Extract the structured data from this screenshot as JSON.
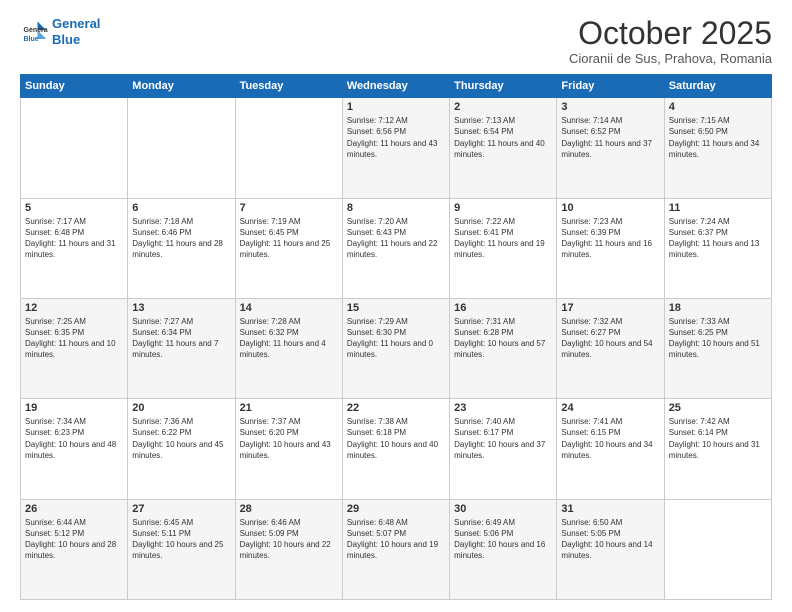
{
  "header": {
    "logo_line1": "General",
    "logo_line2": "Blue",
    "month": "October 2025",
    "location": "Cioranii de Sus, Prahova, Romania"
  },
  "days_of_week": [
    "Sunday",
    "Monday",
    "Tuesday",
    "Wednesday",
    "Thursday",
    "Friday",
    "Saturday"
  ],
  "weeks": [
    [
      {
        "day": "",
        "text": ""
      },
      {
        "day": "",
        "text": ""
      },
      {
        "day": "",
        "text": ""
      },
      {
        "day": "1",
        "text": "Sunrise: 7:12 AM\nSunset: 6:56 PM\nDaylight: 11 hours and 43 minutes."
      },
      {
        "day": "2",
        "text": "Sunrise: 7:13 AM\nSunset: 6:54 PM\nDaylight: 11 hours and 40 minutes."
      },
      {
        "day": "3",
        "text": "Sunrise: 7:14 AM\nSunset: 6:52 PM\nDaylight: 11 hours and 37 minutes."
      },
      {
        "day": "4",
        "text": "Sunrise: 7:15 AM\nSunset: 6:50 PM\nDaylight: 11 hours and 34 minutes."
      }
    ],
    [
      {
        "day": "5",
        "text": "Sunrise: 7:17 AM\nSunset: 6:48 PM\nDaylight: 11 hours and 31 minutes."
      },
      {
        "day": "6",
        "text": "Sunrise: 7:18 AM\nSunset: 6:46 PM\nDaylight: 11 hours and 28 minutes."
      },
      {
        "day": "7",
        "text": "Sunrise: 7:19 AM\nSunset: 6:45 PM\nDaylight: 11 hours and 25 minutes."
      },
      {
        "day": "8",
        "text": "Sunrise: 7:20 AM\nSunset: 6:43 PM\nDaylight: 11 hours and 22 minutes."
      },
      {
        "day": "9",
        "text": "Sunrise: 7:22 AM\nSunset: 6:41 PM\nDaylight: 11 hours and 19 minutes."
      },
      {
        "day": "10",
        "text": "Sunrise: 7:23 AM\nSunset: 6:39 PM\nDaylight: 11 hours and 16 minutes."
      },
      {
        "day": "11",
        "text": "Sunrise: 7:24 AM\nSunset: 6:37 PM\nDaylight: 11 hours and 13 minutes."
      }
    ],
    [
      {
        "day": "12",
        "text": "Sunrise: 7:25 AM\nSunset: 6:35 PM\nDaylight: 11 hours and 10 minutes."
      },
      {
        "day": "13",
        "text": "Sunrise: 7:27 AM\nSunset: 6:34 PM\nDaylight: 11 hours and 7 minutes."
      },
      {
        "day": "14",
        "text": "Sunrise: 7:28 AM\nSunset: 6:32 PM\nDaylight: 11 hours and 4 minutes."
      },
      {
        "day": "15",
        "text": "Sunrise: 7:29 AM\nSunset: 6:30 PM\nDaylight: 11 hours and 0 minutes."
      },
      {
        "day": "16",
        "text": "Sunrise: 7:31 AM\nSunset: 6:28 PM\nDaylight: 10 hours and 57 minutes."
      },
      {
        "day": "17",
        "text": "Sunrise: 7:32 AM\nSunset: 6:27 PM\nDaylight: 10 hours and 54 minutes."
      },
      {
        "day": "18",
        "text": "Sunrise: 7:33 AM\nSunset: 6:25 PM\nDaylight: 10 hours and 51 minutes."
      }
    ],
    [
      {
        "day": "19",
        "text": "Sunrise: 7:34 AM\nSunset: 6:23 PM\nDaylight: 10 hours and 48 minutes."
      },
      {
        "day": "20",
        "text": "Sunrise: 7:36 AM\nSunset: 6:22 PM\nDaylight: 10 hours and 45 minutes."
      },
      {
        "day": "21",
        "text": "Sunrise: 7:37 AM\nSunset: 6:20 PM\nDaylight: 10 hours and 43 minutes."
      },
      {
        "day": "22",
        "text": "Sunrise: 7:38 AM\nSunset: 6:18 PM\nDaylight: 10 hours and 40 minutes."
      },
      {
        "day": "23",
        "text": "Sunrise: 7:40 AM\nSunset: 6:17 PM\nDaylight: 10 hours and 37 minutes."
      },
      {
        "day": "24",
        "text": "Sunrise: 7:41 AM\nSunset: 6:15 PM\nDaylight: 10 hours and 34 minutes."
      },
      {
        "day": "25",
        "text": "Sunrise: 7:42 AM\nSunset: 6:14 PM\nDaylight: 10 hours and 31 minutes."
      }
    ],
    [
      {
        "day": "26",
        "text": "Sunrise: 6:44 AM\nSunset: 5:12 PM\nDaylight: 10 hours and 28 minutes."
      },
      {
        "day": "27",
        "text": "Sunrise: 6:45 AM\nSunset: 5:11 PM\nDaylight: 10 hours and 25 minutes."
      },
      {
        "day": "28",
        "text": "Sunrise: 6:46 AM\nSunset: 5:09 PM\nDaylight: 10 hours and 22 minutes."
      },
      {
        "day": "29",
        "text": "Sunrise: 6:48 AM\nSunset: 5:07 PM\nDaylight: 10 hours and 19 minutes."
      },
      {
        "day": "30",
        "text": "Sunrise: 6:49 AM\nSunset: 5:06 PM\nDaylight: 10 hours and 16 minutes."
      },
      {
        "day": "31",
        "text": "Sunrise: 6:50 AM\nSunset: 5:05 PM\nDaylight: 10 hours and 14 minutes."
      },
      {
        "day": "",
        "text": ""
      }
    ]
  ]
}
